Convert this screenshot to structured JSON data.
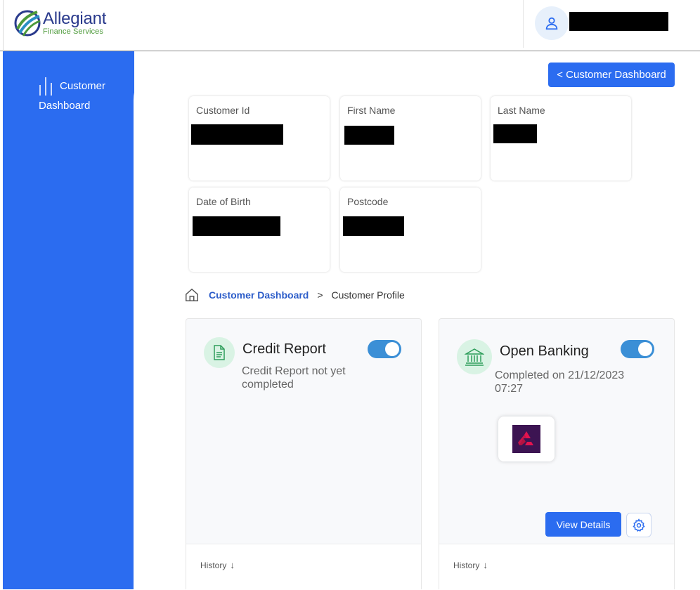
{
  "brand": {
    "name": "Allegiant",
    "tagline": "Finance Services",
    "colors": {
      "primary": "#2b6cf0",
      "navy": "#2a3a8c",
      "green": "#4d9a3a"
    }
  },
  "header": {
    "user_icon": "user-icon"
  },
  "sidebar": {
    "items": [
      {
        "label": "Customer Dashboard",
        "icon": "bar-chart-icon"
      }
    ]
  },
  "actions": {
    "back_label": "< Customer Dashboard"
  },
  "customer": {
    "fields": [
      {
        "label": "Customer Id"
      },
      {
        "label": "First Name"
      },
      {
        "label": "Last Name"
      },
      {
        "label": "Date of Birth"
      },
      {
        "label": "Postcode"
      }
    ]
  },
  "breadcrumb": {
    "home_icon": "home-icon",
    "link": "Customer Dashboard",
    "separator": ">",
    "current": "Customer Profile"
  },
  "panels": {
    "credit": {
      "icon": "document-icon",
      "title": "Credit Report",
      "status": "Credit Report not yet completed",
      "toggle_on": true,
      "history_label": "History"
    },
    "banking": {
      "icon": "bank-icon",
      "title": "Open Banking",
      "status": "Completed on 21/12/2023 07:27",
      "toggle_on": true,
      "bank_logo_icon": "natwest-logo-icon",
      "view_details_label": "View Details",
      "settings_icon": "gear-icon",
      "history_label": "History"
    }
  }
}
